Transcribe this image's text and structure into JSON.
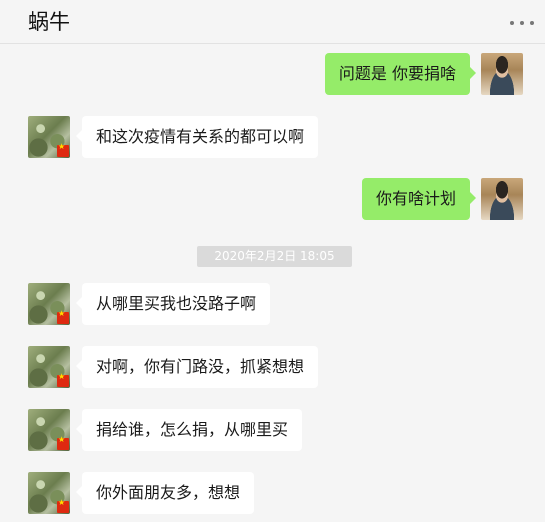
{
  "header": {
    "title": "蜗牛",
    "more_icon": "more-dots-icon"
  },
  "colors": {
    "background": "#f5f5f5",
    "self_bubble": "#95ec69",
    "other_bubble": "#ffffff",
    "timestamp_bg": "#dadada"
  },
  "messages": [
    {
      "sender": "self",
      "text": "问题是 你要捐啥"
    },
    {
      "sender": "other",
      "text": "和这次疫情有关系的都可以啊"
    },
    {
      "sender": "self",
      "text": "你有啥计划"
    },
    {
      "sender": "other",
      "text": "从哪里买我也没路子啊"
    },
    {
      "sender": "other",
      "text": "对啊，你有门路没，抓紧想想"
    },
    {
      "sender": "other",
      "text": "捐给谁，怎么捐，从哪里买"
    },
    {
      "sender": "other",
      "text": "你外面朋友多，想想"
    }
  ],
  "timestamp": "2020年2月2日 18:05"
}
